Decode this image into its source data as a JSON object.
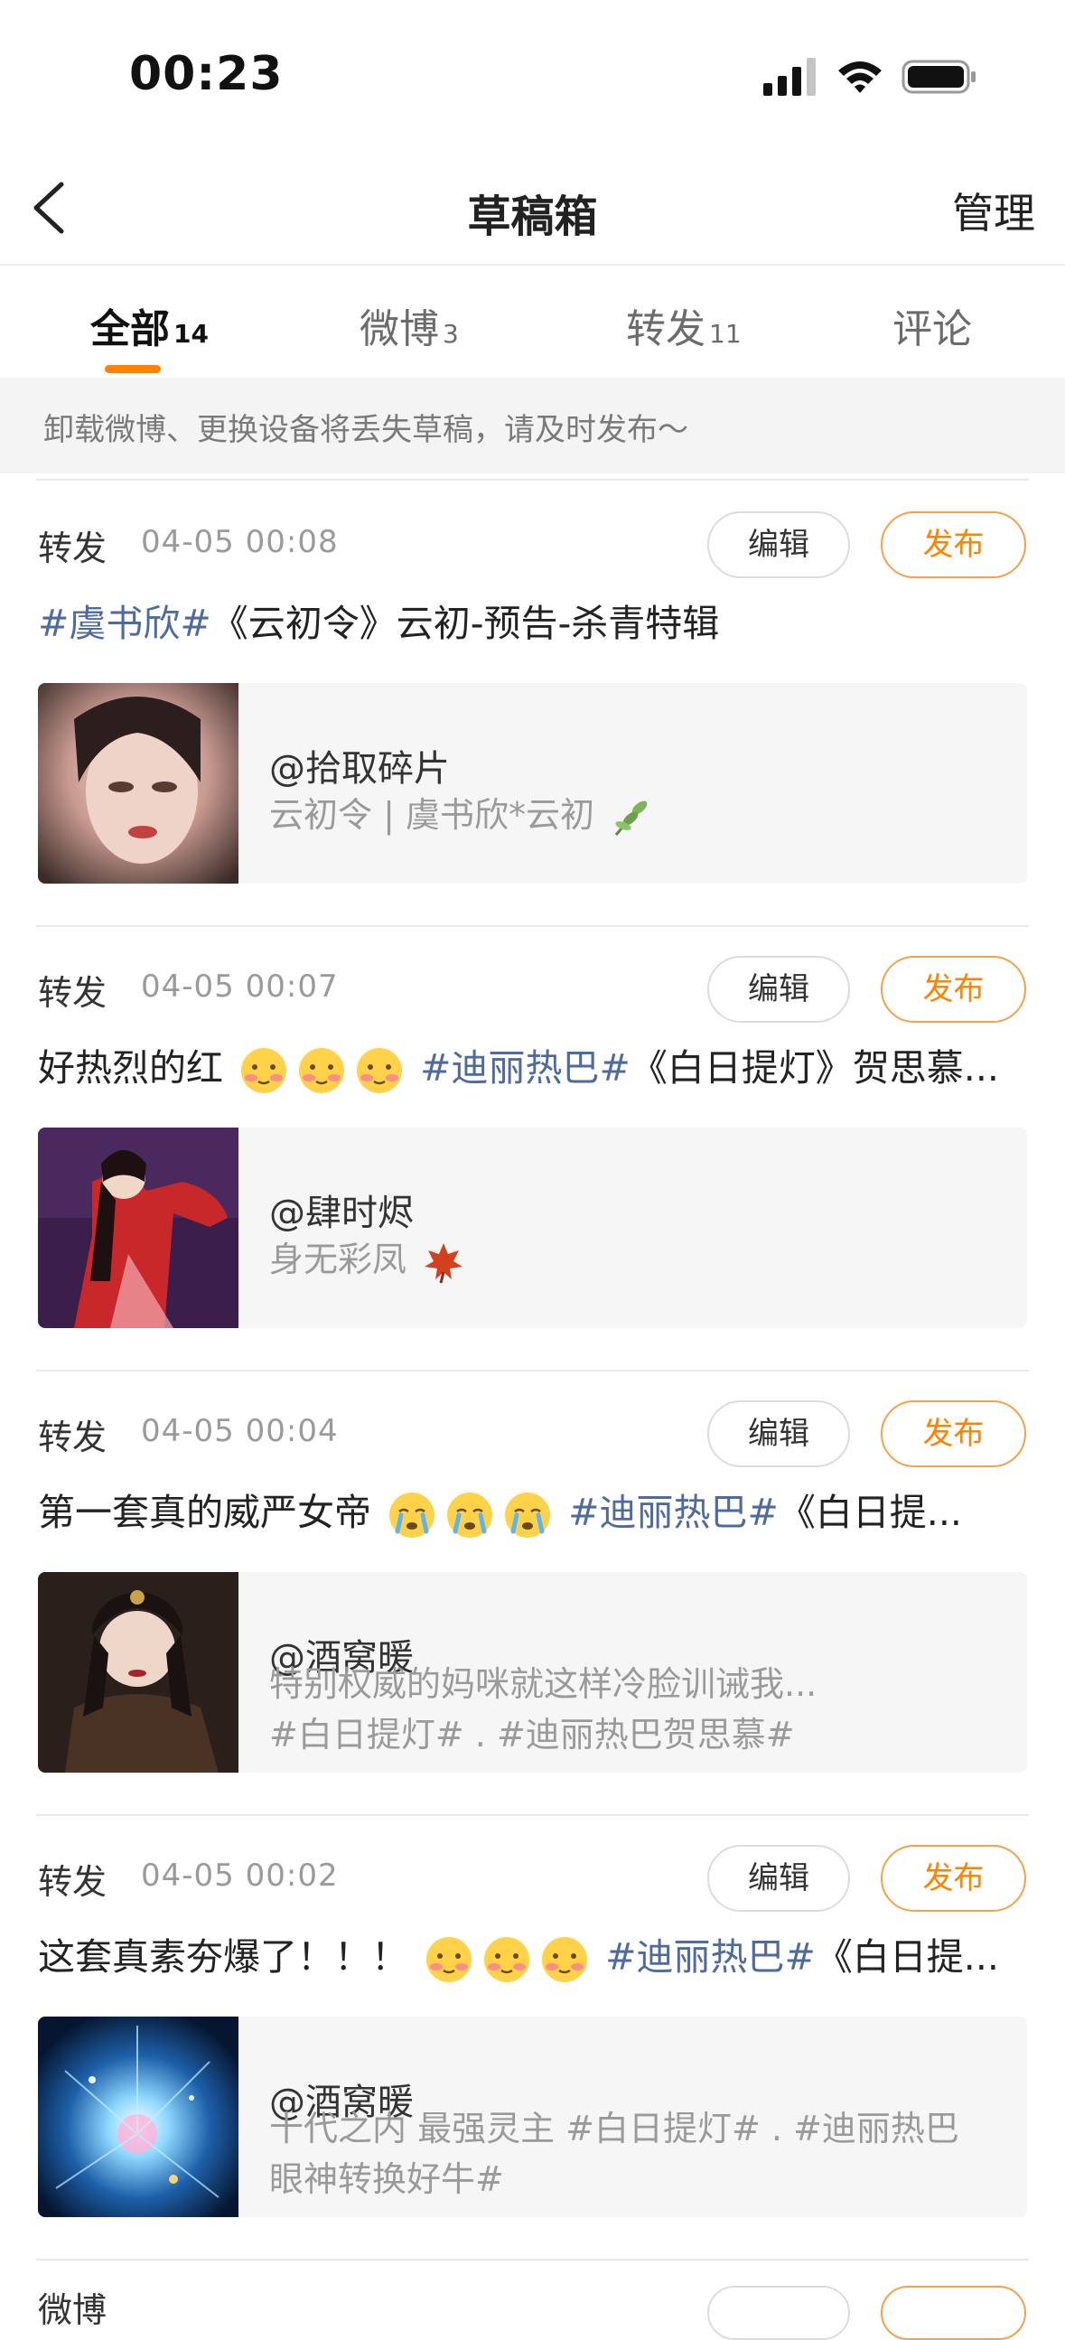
{
  "status_bar": {
    "time": "00:23"
  },
  "nav": {
    "title": "草稿箱",
    "manage_label": "管理"
  },
  "tabs": [
    {
      "label": "全部",
      "count": "14",
      "active": true
    },
    {
      "label": "微博",
      "count": "3",
      "active": false
    },
    {
      "label": "转发",
      "count": "11",
      "active": false
    },
    {
      "label": "评论",
      "count": "",
      "active": false
    }
  ],
  "notice": "卸载微博、更换设备将丢失草稿，请及时发布～",
  "buttons": {
    "edit": "编辑",
    "publish": "发布"
  },
  "drafts": [
    {
      "type": "转发",
      "time": "04-05 00:08",
      "text_tag": "#虞书欣#",
      "text_rest": "《云初令》云初-预告-杀青特辑",
      "card_user": "@拾取碎片",
      "card_desc": "云初令 | 虞书欣*云初"
    },
    {
      "type": "转发",
      "time": "04-05 00:07",
      "text_pre": "好热烈的红",
      "text_tag": "#迪丽热巴#",
      "text_rest": "《白日提灯》贺思慕...",
      "card_user": "@肆时烬",
      "card_desc": "身无彩凤"
    },
    {
      "type": "转发",
      "time": "04-05 00:04",
      "text_pre": "第一套真的威严女帝",
      "text_tag": "#迪丽热巴#",
      "text_rest": "《白日提...",
      "card_user": "@酒窝暖",
      "card_desc_1": "特别权威的妈咪就这样冷脸训诫我...",
      "card_desc_2": "#白日提灯# . #迪丽热巴贺思慕#"
    },
    {
      "type": "转发",
      "time": "04-05 00:02",
      "text_pre": "这套真素夯爆了！！！",
      "text_tag": "#迪丽热巴#",
      "text_rest": "《白日提...",
      "card_user": "@酒窝暖",
      "card_desc_1": "十代之内 最强灵主 #白日提灯# . #迪丽热巴",
      "card_desc_2": "眼神转换好牛#"
    }
  ],
  "partial_next": {
    "type": "微博"
  }
}
